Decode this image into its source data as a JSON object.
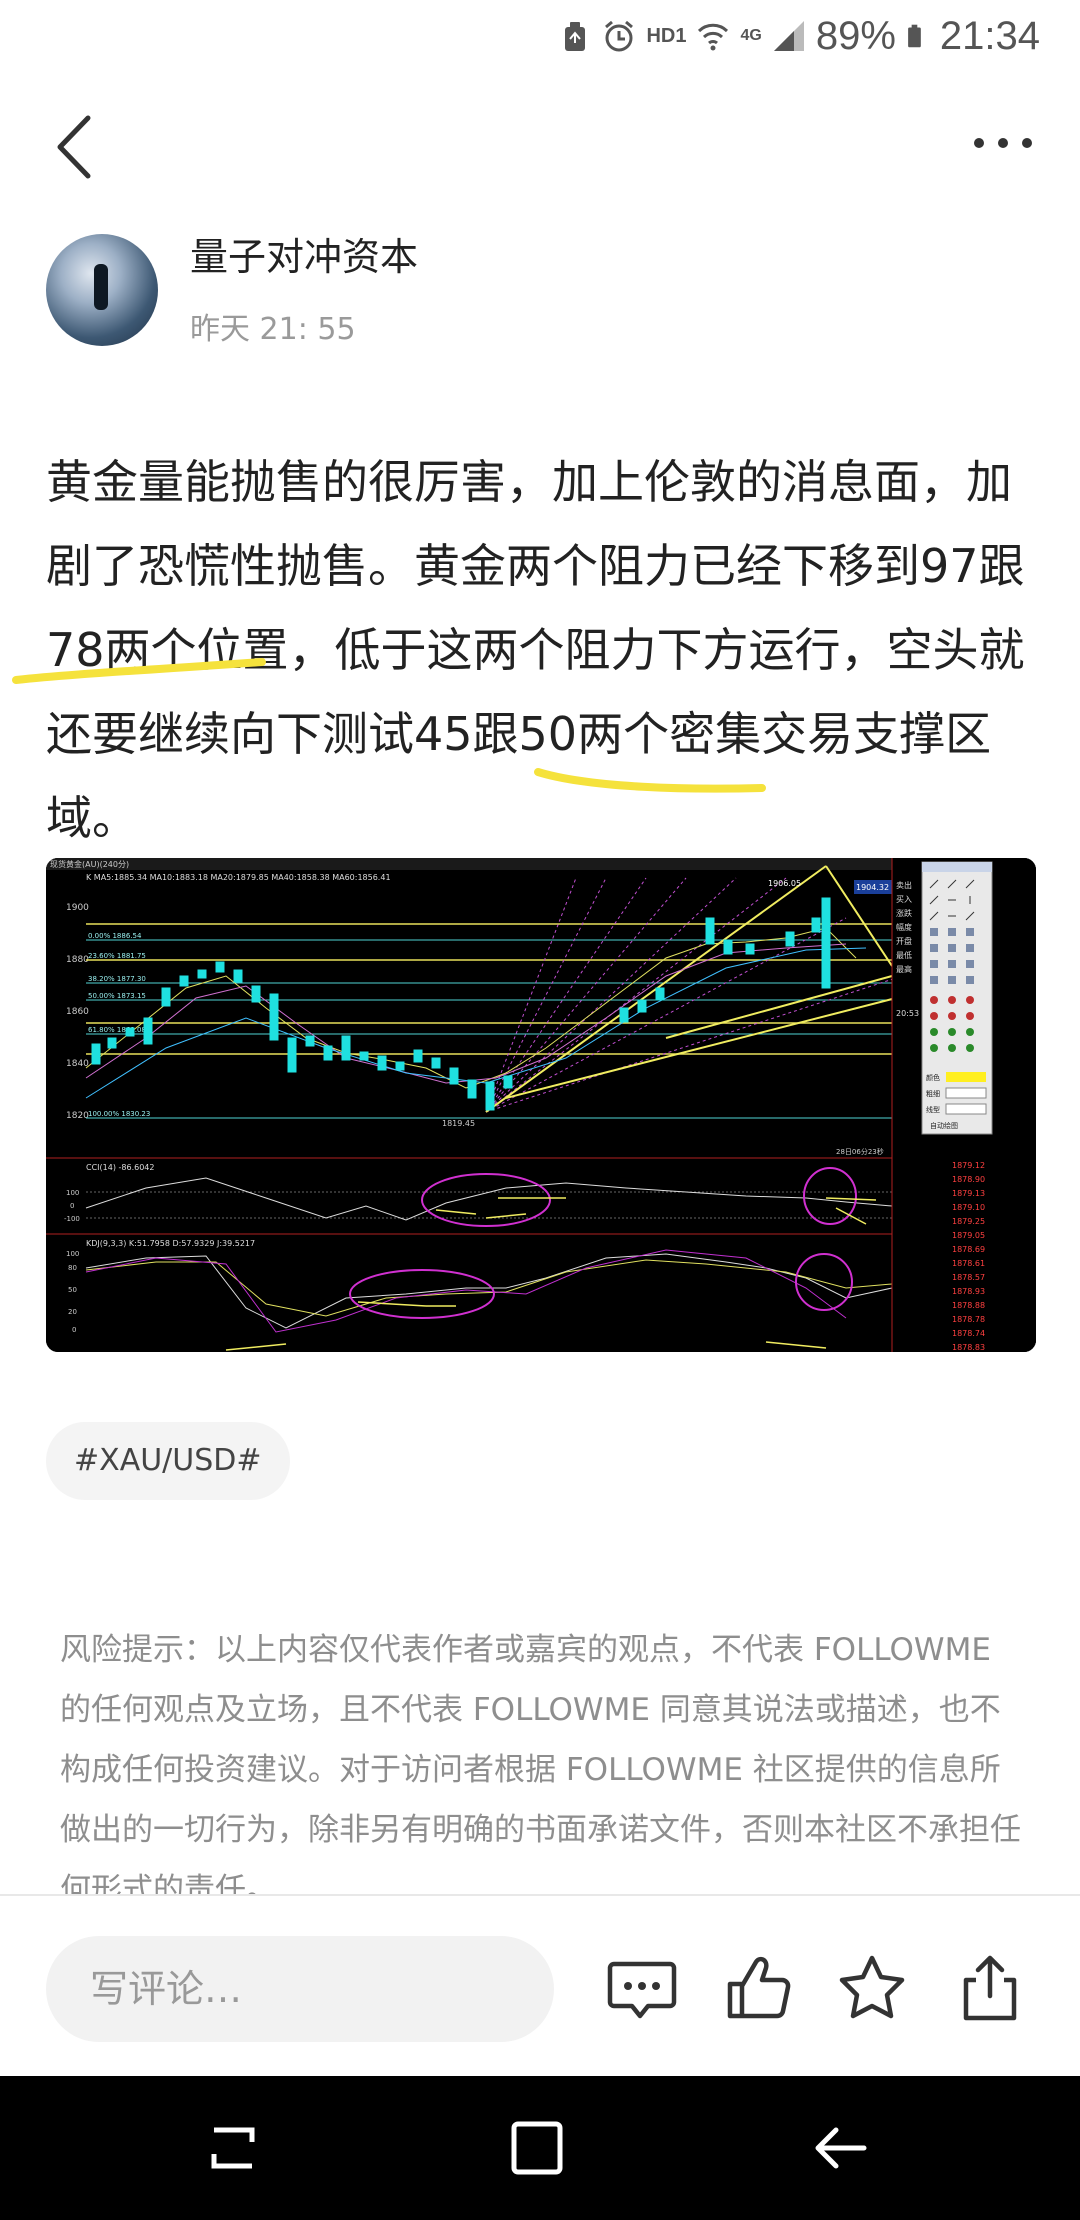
{
  "status_bar": {
    "network": "HD1",
    "signal": "4G",
    "battery": "89%",
    "time": "21:34"
  },
  "post": {
    "author": "量子对冲资本",
    "time": "昨天 21: 55",
    "text": "黄金量能抛售的很厉害，加上伦敦的消息面，加剧了恐慌性抛售。黄金两个阻力已经下移到97跟78两个位置，低于这两个阻力下方运行，空头就还要继续向下测试45跟50两个密集交易支撑区域。",
    "tag": "#XAU/USD#"
  },
  "chart_image": {
    "title": "现货黄金(AU)(240分)",
    "ma_legend": "K  MA5:1885.34  MA10:1883.18  MA20:1879.85  MA40:1858.38  MA60:1856.41",
    "price_labels": [
      "1900",
      "1880",
      "1860",
      "1840",
      "1820"
    ],
    "fib_labels": [
      "0.00% 1886.54",
      "23.60% 1881.75",
      "38.20% 1877.30",
      "50.00% 1873.15",
      "61.80% 1869.08",
      "100.00% 1830.23"
    ],
    "low_label": "1819.45",
    "high_label": "1906.05",
    "current_price": "1904.32",
    "cci_label": "CCI(14)  -86.6042",
    "cci_ticks": [
      "100",
      "0",
      "-100"
    ],
    "kdj_label": "KDJ(9,3,3)  K:51.7958  D:57.9329  J:39.5217",
    "kdj_ticks": [
      "100",
      "80",
      "50",
      "20",
      "0"
    ],
    "time_label": "28日06分23秒",
    "quote_side": [
      "卖出",
      "买入",
      "涨跌",
      "幅度",
      "开盘",
      "最低",
      "最高",
      "20:53"
    ],
    "tick_prices": [
      "1879.12",
      "1878.90",
      "1879.13",
      "1879.10",
      "1879.25",
      "1879.05",
      "1878.69",
      "1878.61",
      "1878.57",
      "1878.93",
      "1878.88",
      "1878.78",
      "1878.74",
      "1878.83"
    ],
    "color_label": "颜色",
    "line_width_label": "粗细",
    "line_type_label": "线型",
    "auto_label": "自动绘图"
  },
  "disclaimer": "风险提示：以上内容仅代表作者或嘉宾的观点，不代表 FOLLOWME 的任何观点及立场，且不代表 FOLLOWME 同意其说法或描述，也不构成任何投资建议。对于访问者根据 FOLLOWME 社区提供的信息所做出的一切行为，除非另有明确的书面承诺文件，否则本社区不承担任何形式的责任。",
  "comment": {
    "placeholder": "写评论…"
  },
  "colors": {
    "highlight": "#f5e23c",
    "chart_bg": "#000000",
    "candle": "#1fe0e0"
  }
}
